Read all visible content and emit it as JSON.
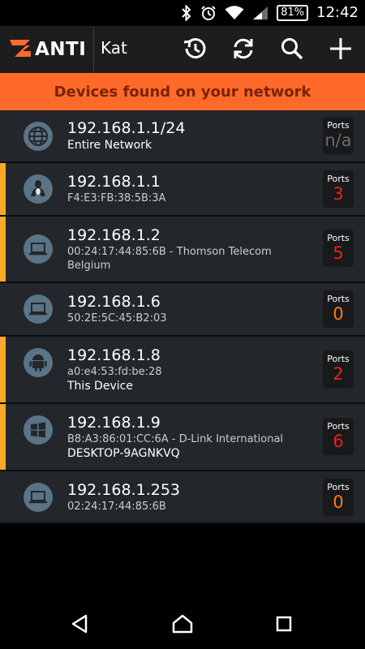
{
  "status_bar": {
    "battery": "81%",
    "time": "12:42"
  },
  "app": {
    "logo_text": "ANTI",
    "title": "Kat"
  },
  "banner": {
    "text": "Devices found on your network"
  },
  "devices": [
    {
      "ip": "192.168.1.1/24",
      "line2": "",
      "line3": "Entire Network",
      "ports": "n/a",
      "icon": "globe-icon",
      "highlight": false
    },
    {
      "ip": "192.168.1.1",
      "line2": "F4:E3:FB:38:5B:3A",
      "line3": "",
      "ports": "3",
      "icon": "linux-icon",
      "highlight": true
    },
    {
      "ip": "192.168.1.2",
      "line2": "00:24:17:44:85:6B - Thomson Telecom Belgium",
      "line3": "",
      "ports": "5",
      "icon": "laptop-icon",
      "highlight": true
    },
    {
      "ip": "192.168.1.6",
      "line2": "50:2E:5C:45:B2:03",
      "line3": "",
      "ports": "0",
      "icon": "laptop-icon",
      "highlight": false
    },
    {
      "ip": "192.168.1.8",
      "line2": "a0:e4:53:fd:be:28",
      "line3": "This Device",
      "ports": "2",
      "icon": "android-icon",
      "highlight": true
    },
    {
      "ip": "192.168.1.9",
      "line2": "B8:A3:86:01:CC:6A - D-Link International",
      "line3": "DESKTOP-9AGNKVQ",
      "ports": "6",
      "icon": "windows-icon",
      "highlight": true
    },
    {
      "ip": "192.168.1.253",
      "line2": "02:24:17:44:85:6B",
      "line3": "",
      "ports": "0",
      "icon": "laptop-icon",
      "highlight": false
    }
  ],
  "ports_label": "Ports",
  "colors": {
    "accent": "#ff6a2a",
    "highlight": "#ffa726",
    "ports_red": "#e8231b",
    "ports_orange": "#ff7a1a",
    "na_gray": "#6a6d70"
  }
}
